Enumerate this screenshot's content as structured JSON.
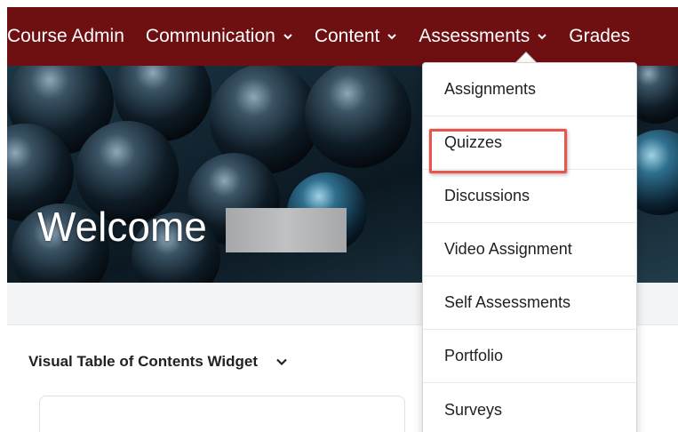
{
  "nav": {
    "items": [
      {
        "label": "Course Admin",
        "has_menu": false
      },
      {
        "label": "Communication",
        "has_menu": true
      },
      {
        "label": "Content",
        "has_menu": true
      },
      {
        "label": "Assessments",
        "has_menu": true
      },
      {
        "label": "Grades",
        "has_menu": false
      }
    ]
  },
  "hero": {
    "welcome_text": "Welcome"
  },
  "widget": {
    "title": "Visual Table of Contents Widget"
  },
  "assessments_menu": {
    "items": [
      {
        "label": "Assignments"
      },
      {
        "label": "Quizzes"
      },
      {
        "label": "Discussions"
      },
      {
        "label": "Video Assignment"
      },
      {
        "label": "Self Assessments"
      },
      {
        "label": "Portfolio"
      },
      {
        "label": "Surveys"
      }
    ],
    "highlighted_item": "Quizzes"
  },
  "colors": {
    "nav_background": "#6e0f12",
    "highlight_border": "#e4574f"
  }
}
